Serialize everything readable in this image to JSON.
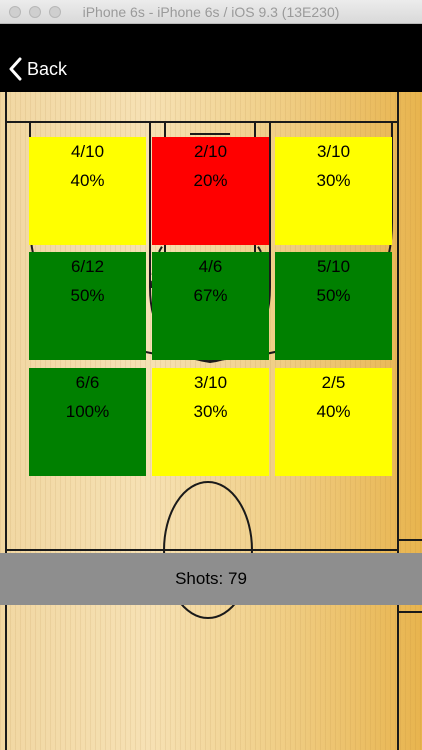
{
  "window": {
    "title": "iPhone 6s - iPhone 6s / iOS 9.3 (13E230)"
  },
  "nav": {
    "back_label": "Back",
    "back_icon": "chevron-left-icon"
  },
  "colors": {
    "red": "#ff0000",
    "yellow": "#ffff00",
    "green": "#008000",
    "stats_bar": "#8e8e8e"
  },
  "zones": [
    {
      "made": "4/10",
      "pct": "40%",
      "color": "#ffff00"
    },
    {
      "made": "2/10",
      "pct": "20%",
      "color": "#ff0000"
    },
    {
      "made": "3/10",
      "pct": "30%",
      "color": "#ffff00"
    },
    {
      "made": "6/12",
      "pct": "50%",
      "color": "#008000"
    },
    {
      "made": "4/6",
      "pct": "67%",
      "color": "#008000"
    },
    {
      "made": "5/10",
      "pct": "50%",
      "color": "#008000"
    },
    {
      "made": "6/6",
      "pct": "100%",
      "color": "#008000"
    },
    {
      "made": "3/10",
      "pct": "30%",
      "color": "#ffff00"
    },
    {
      "made": "2/5",
      "pct": "40%",
      "color": "#ffff00"
    }
  ],
  "stats": {
    "shots_label": "Shots: 79"
  }
}
